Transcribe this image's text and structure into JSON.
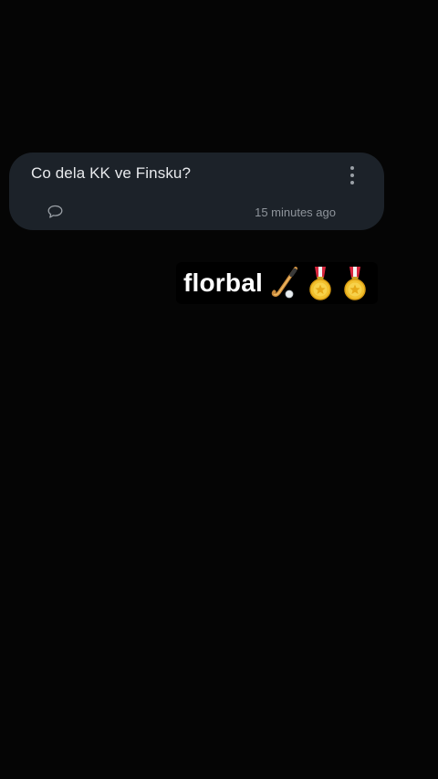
{
  "question_card": {
    "text": "Co dela KK ve Finsku?",
    "timestamp": "15 minutes ago",
    "comment_icon": "comment-bubble-icon",
    "menu_icon": "vertical-dots-icon"
  },
  "reply": {
    "text": "florbal",
    "emojis": [
      "field-hockey-stick-icon",
      "gold-medal-icon",
      "gold-medal-icon"
    ]
  },
  "colors": {
    "background": "#050505",
    "card": "#1c2229",
    "text_primary": "#e8eaed",
    "text_secondary": "#8e949b",
    "medal_gold": "#f2c12e",
    "ribbon_red": "#d7263d"
  }
}
